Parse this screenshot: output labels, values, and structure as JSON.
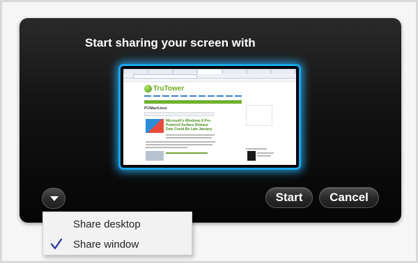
{
  "dialog": {
    "title": "Start sharing your screen with"
  },
  "preview": {
    "site_name": "TruTower",
    "section_heading": "PC/Mac/Linux",
    "article_title": "Microsoft's Windows 8 Pro-Powered Surface Release Date Could Be Late January"
  },
  "buttons": {
    "start": "Start",
    "cancel": "Cancel"
  },
  "share_menu": {
    "items": [
      {
        "label": "Share desktop",
        "checked": false
      },
      {
        "label": "Share window",
        "checked": true
      }
    ]
  },
  "colors": {
    "accent_glow": "#19a7ea",
    "check": "#2a3f9e"
  }
}
